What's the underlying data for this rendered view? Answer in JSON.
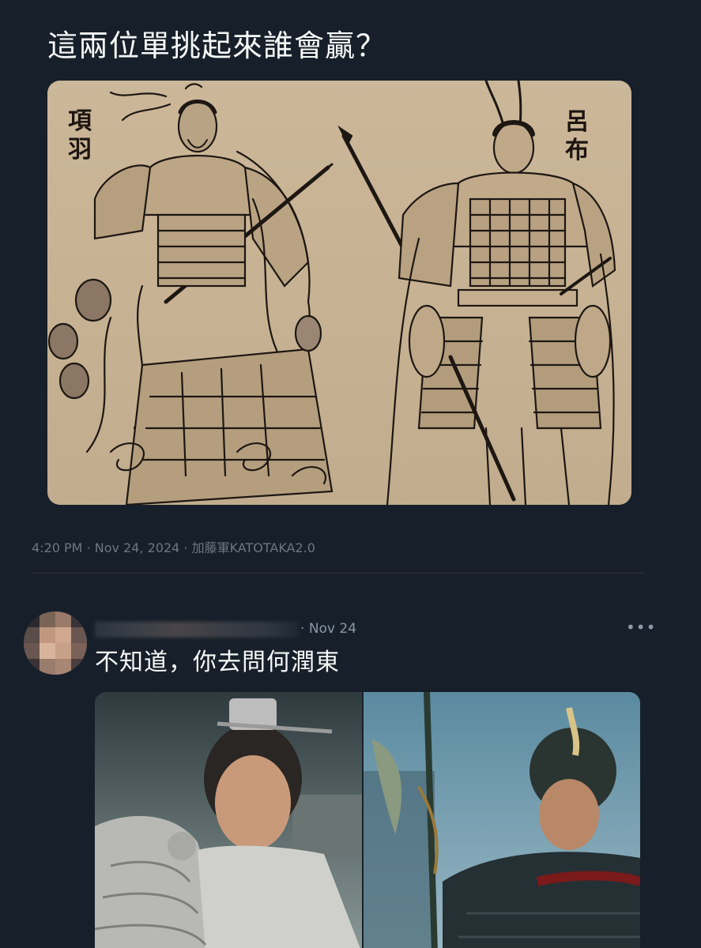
{
  "post": {
    "text": "這兩位單挑起來誰會贏？",
    "image": {
      "left_name": "項羽",
      "right_name": "呂布"
    },
    "time": "4:20 PM",
    "date": "Nov 24, 2024",
    "source": "加藤軍KATOTAKA2.0"
  },
  "reply": {
    "date": "Nov 24",
    "text": "不知道，你去問何潤東",
    "more_icon": "more-horizontal-icon"
  },
  "colors": {
    "background": "#17202a",
    "text_primary": "#f7f9f9",
    "text_secondary": "#6e767d",
    "divider": "#2f3336"
  }
}
